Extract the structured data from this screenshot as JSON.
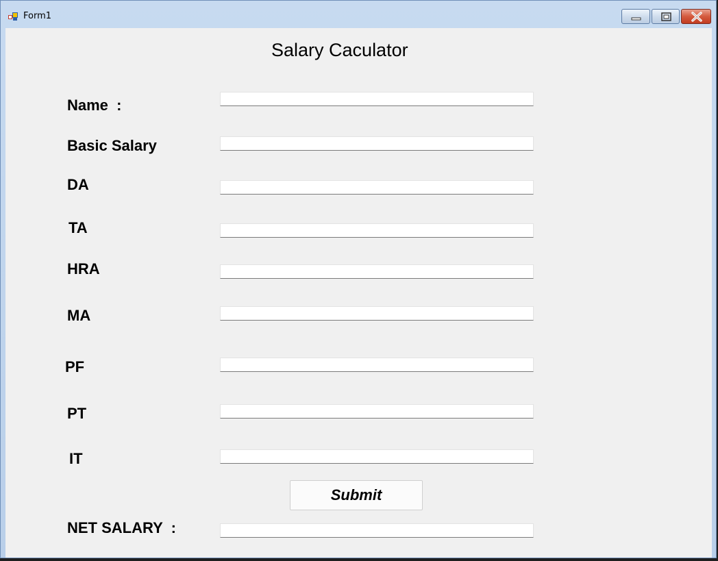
{
  "window": {
    "title": "Form1"
  },
  "form": {
    "heading": "Salary Caculator",
    "fields": [
      {
        "label": "Name  :",
        "value": ""
      },
      {
        "label": "Basic Salary",
        "value": ""
      },
      {
        "label": "DA",
        "value": ""
      },
      {
        "label": "TA",
        "value": ""
      },
      {
        "label": "HRA",
        "value": ""
      },
      {
        "label": "MA",
        "value": ""
      },
      {
        "label": "PF",
        "value": ""
      },
      {
        "label": "PT",
        "value": ""
      },
      {
        "label": "IT",
        "value": ""
      }
    ],
    "submit_label": "Submit",
    "net_salary": {
      "label": "NET SALARY  :",
      "value": ""
    }
  },
  "colors": {
    "titlebar": "#c7daf0",
    "client_background": "#f0f0f0",
    "close_button": "#c23d22"
  },
  "icons": [
    "app-icon",
    "minimize-icon",
    "maximize-icon",
    "close-icon"
  ]
}
